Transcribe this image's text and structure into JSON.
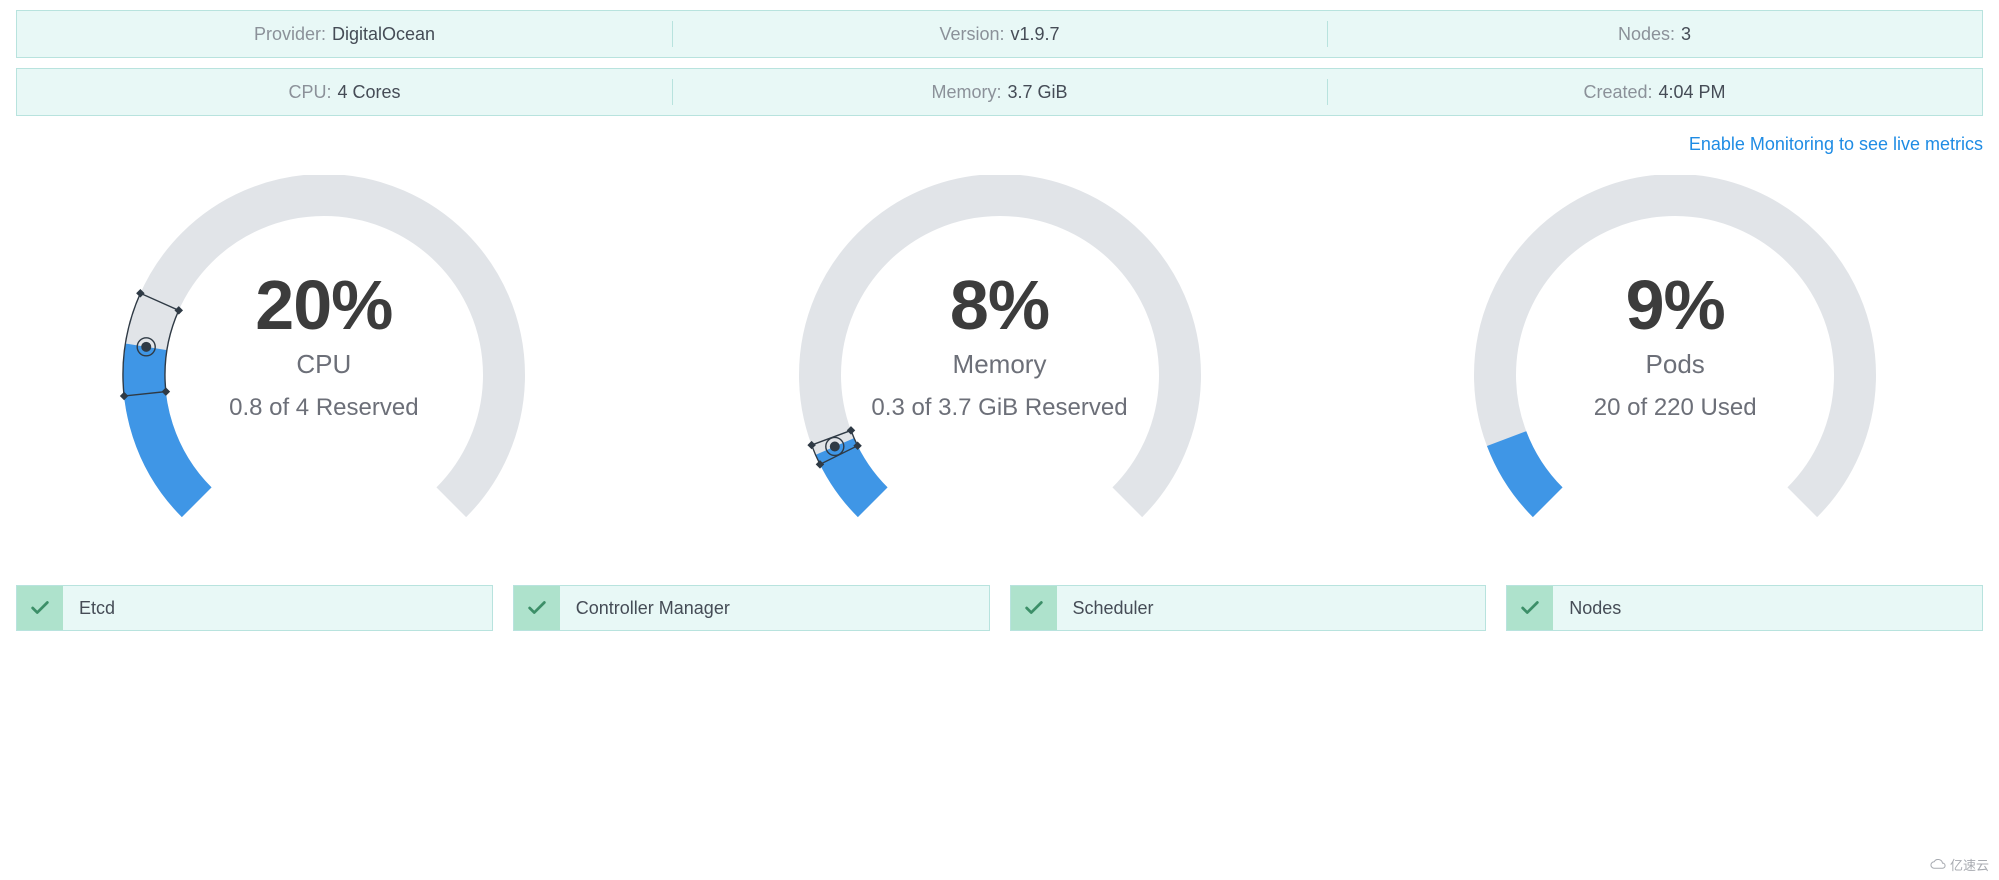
{
  "info_bars": [
    {
      "cells": [
        {
          "label": "Provider:",
          "value": "DigitalOcean"
        },
        {
          "label": "Version:",
          "value": "v1.9.7"
        },
        {
          "label": "Nodes:",
          "value": "3"
        }
      ]
    },
    {
      "cells": [
        {
          "label": "CPU:",
          "value": "4 Cores"
        },
        {
          "label": "Memory:",
          "value": "3.7 GiB"
        },
        {
          "label": "Created:",
          "value": "4:04 PM"
        }
      ]
    }
  ],
  "monitoring_link": "Enable Monitoring to see live metrics",
  "gauges": [
    {
      "pct_text": "20%",
      "pct": 20,
      "title": "CPU",
      "subtitle": "0.8 of 4 Reserved",
      "marker": true,
      "marker_span": 30
    },
    {
      "pct_text": "8%",
      "pct": 8,
      "title": "Memory",
      "subtitle": "0.3 of 3.7 GiB Reserved",
      "marker": true,
      "marker_span": 6
    },
    {
      "pct_text": "9%",
      "pct": 9,
      "title": "Pods",
      "subtitle": "20 of 220 Used",
      "marker": false,
      "marker_span": 0
    }
  ],
  "status_items": [
    "Etcd",
    "Controller Manager",
    "Scheduler",
    "Nodes"
  ],
  "watermark": "亿速云",
  "chart_data": [
    {
      "type": "gauge",
      "title": "CPU",
      "value": 0.8,
      "max": 4,
      "unit": "Cores",
      "percent": 20,
      "label": "0.8 of 4 Reserved"
    },
    {
      "type": "gauge",
      "title": "Memory",
      "value": 0.3,
      "max": 3.7,
      "unit": "GiB",
      "percent": 8,
      "label": "0.3 of 3.7 GiB Reserved"
    },
    {
      "type": "gauge",
      "title": "Pods",
      "value": 20,
      "max": 220,
      "unit": "",
      "percent": 9,
      "label": "20 of 220 Used"
    }
  ],
  "colors": {
    "track": "#e1e4e8",
    "fill": "#3f96e6",
    "marker_stroke": "#2f3a45"
  }
}
